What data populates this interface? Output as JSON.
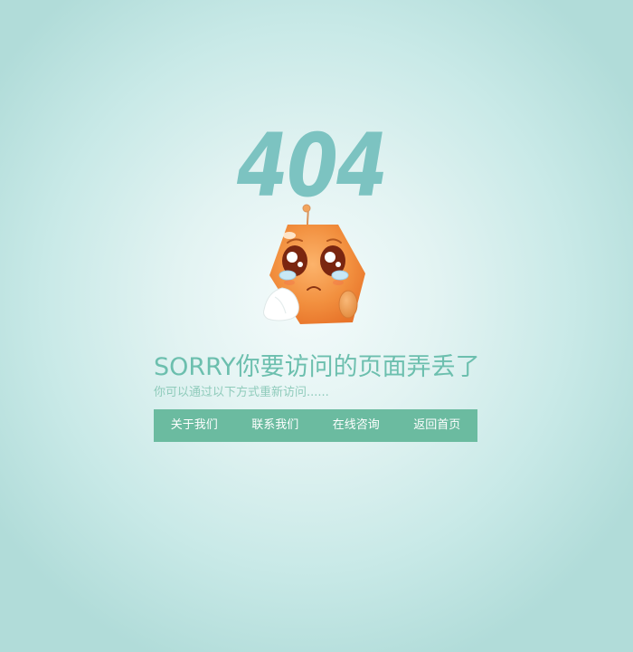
{
  "error": {
    "code": "404",
    "headline": "SORRY你要访问的页面弄丢了",
    "subline": "你可以通过以下方式重新访问......"
  },
  "nav": {
    "items": [
      {
        "label": "关于我们"
      },
      {
        "label": "联系我们"
      },
      {
        "label": "在线咨询"
      },
      {
        "label": "返回首页"
      }
    ]
  },
  "colors": {
    "accent": "#7cc3c1",
    "headline": "#6cbfae",
    "nav_bg": "#6bbba0",
    "mascot_body": "#f28a3c"
  },
  "icons": {
    "mascot": "crying-orange-hexagon-mascot-icon"
  }
}
